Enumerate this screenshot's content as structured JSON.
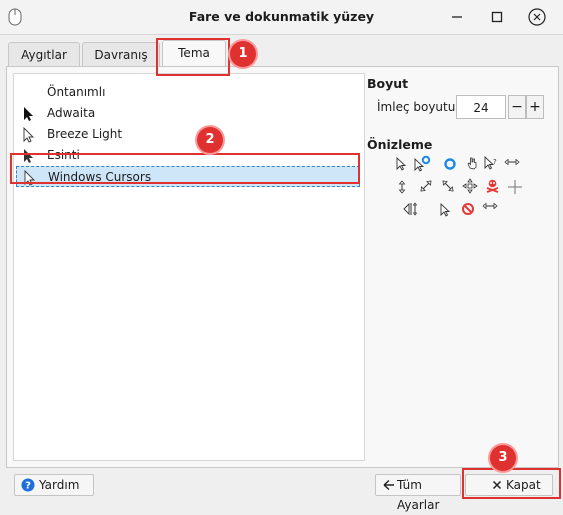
{
  "window": {
    "title": "Fare ve dokunmatik yüzey"
  },
  "tabs": [
    {
      "label": "Aygıtlar"
    },
    {
      "label": "Davranış"
    },
    {
      "label": "Tema"
    }
  ],
  "cursor_themes": [
    {
      "label": "Öntanımlı",
      "icon": "none"
    },
    {
      "label": "Adwaita",
      "icon": "black-arrow-cursor-icon"
    },
    {
      "label": "Breeze Light",
      "icon": "white-arrow-cursor-icon"
    },
    {
      "label": "Esinti",
      "icon": "black-arrow-cursor-icon"
    },
    {
      "label": "Windows Cursors",
      "icon": "white-arrow-cursor-icon"
    }
  ],
  "selected_theme": "Windows Cursors",
  "size": {
    "section_title": "Boyut",
    "label": "İmleç boyutu:",
    "value": "24",
    "minus": "−",
    "plus": "+"
  },
  "preview": {
    "section_title": "Önizleme",
    "icons": [
      "arrow-cursor-icon",
      "busy-arrow-cursor-icon",
      "busy-ring-cursor-icon",
      "hand-cursor-icon",
      "help-cursor-icon",
      "horizontal-resize-cursor-icon",
      "vertical-resize-cursor-icon",
      "diagonal-resize-cursor-icon",
      "diagonal-resize-alt-cursor-icon",
      "move-cursor-icon",
      "pirate-cursor-icon",
      "crosshair-cursor-icon",
      "link-cursor-icon",
      "arrow-small-cursor-icon",
      "not-allowed-cursor-icon",
      "horizontal-resize-small-cursor-icon"
    ]
  },
  "footer": {
    "help_label": "Yardım",
    "all_settings_label": "Tüm Ayarlar",
    "close_label": "Kapat"
  },
  "annotations": [
    {
      "number": "1"
    },
    {
      "number": "2"
    },
    {
      "number": "3"
    }
  ],
  "colors": {
    "selection": "#cfe6f9",
    "annotation": "#e03131"
  }
}
